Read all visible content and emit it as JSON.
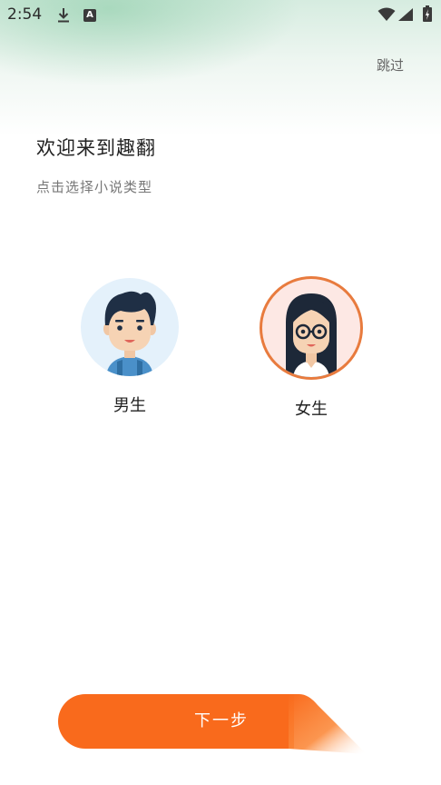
{
  "status_bar": {
    "time": "2:54",
    "icons": [
      "download-icon",
      "a-icon",
      "wifi-icon",
      "signal-icon",
      "battery-icon"
    ],
    "a_icon_text": "A"
  },
  "header": {
    "skip_label": "跳过"
  },
  "main": {
    "title": "欢迎来到趣翻",
    "subtitle": "点击选择小说类型",
    "choices": [
      {
        "label": "男生",
        "icon": "male-avatar-icon",
        "selected": false
      },
      {
        "label": "女生",
        "icon": "female-avatar-icon",
        "selected": true
      }
    ]
  },
  "footer": {
    "next_label": "下一步"
  },
  "colors": {
    "accent": "#f96a1c",
    "selected_border": "#e87b3e",
    "male_bg": "#e4f1fb",
    "female_bg": "#fde8e4"
  }
}
